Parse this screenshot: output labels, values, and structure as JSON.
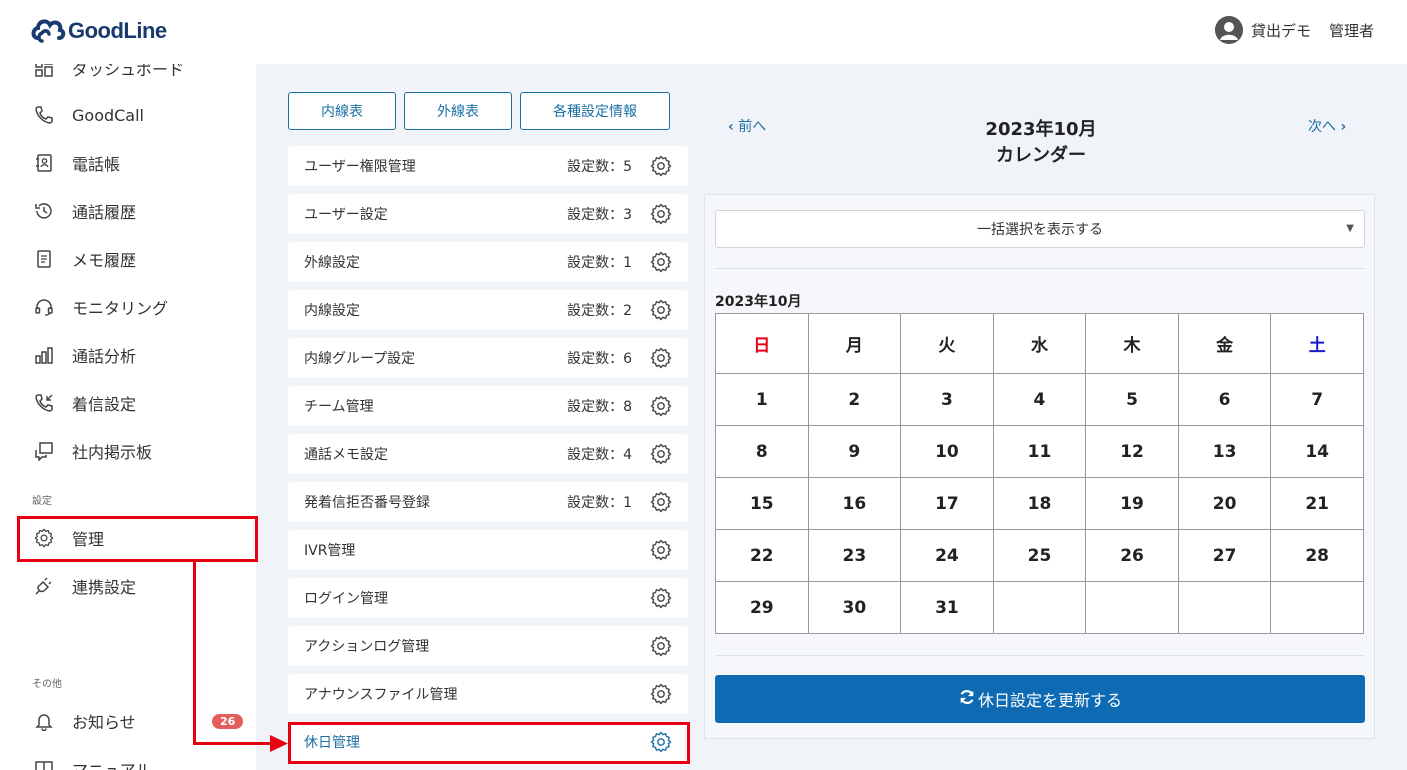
{
  "header": {
    "logo_text": "GoodLine",
    "user_name": "貸出デモ",
    "user_role": "管理者"
  },
  "sidebar": {
    "items": [
      {
        "label": "ダッシュボード",
        "icon": "dashboard-icon"
      },
      {
        "label": "GoodCall",
        "icon": "phone-icon"
      },
      {
        "label": "電話帳",
        "icon": "contacts-icon"
      },
      {
        "label": "通話履歴",
        "icon": "history-icon"
      },
      {
        "label": "メモ履歴",
        "icon": "memo-icon"
      },
      {
        "label": "モニタリング",
        "icon": "headset-icon"
      },
      {
        "label": "通話分析",
        "icon": "bar-chart-icon"
      },
      {
        "label": "着信設定",
        "icon": "incoming-call-icon"
      },
      {
        "label": "社内掲示板",
        "icon": "board-icon"
      }
    ],
    "section_settings": "設定",
    "settings_items": [
      {
        "label": "管理",
        "icon": "gear-icon"
      },
      {
        "label": "連携設定",
        "icon": "plug-icon"
      }
    ],
    "section_other": "その他",
    "other_items": [
      {
        "label": "お知らせ",
        "icon": "bell-icon",
        "badge": "26"
      },
      {
        "label": "マニュアル",
        "icon": "manual-icon"
      }
    ]
  },
  "top_buttons": [
    "内線表",
    "外線表",
    "各種設定情報"
  ],
  "settings_list": [
    {
      "label": "ユーザー権限管理",
      "count": "設定数：5"
    },
    {
      "label": "ユーザー設定",
      "count": "設定数：3"
    },
    {
      "label": "外線設定",
      "count": "設定数：1"
    },
    {
      "label": "内線設定",
      "count": "設定数：2"
    },
    {
      "label": "内線グループ設定",
      "count": "設定数：6"
    },
    {
      "label": "チーム管理",
      "count": "設定数：8"
    },
    {
      "label": "通話メモ設定",
      "count": "設定数：4"
    },
    {
      "label": "発着信拒否番号登録",
      "count": "設定数：1"
    },
    {
      "label": "IVR管理",
      "count": ""
    },
    {
      "label": "ログイン管理",
      "count": ""
    },
    {
      "label": "アクションログ管理",
      "count": ""
    },
    {
      "label": "アナウンスファイル管理",
      "count": ""
    },
    {
      "label": "休日管理",
      "count": ""
    }
  ],
  "calendar": {
    "prev_label": "前へ",
    "next_label": "次へ",
    "title_line1": "2023年10月",
    "title_line2": "カレンダー",
    "bulk_select_label": "一括選択を表示する",
    "month_label": "2023年10月",
    "weekdays": [
      "日",
      "月",
      "火",
      "水",
      "木",
      "金",
      "土"
    ],
    "weeks": [
      [
        "1",
        "2",
        "3",
        "4",
        "5",
        "6",
        "7"
      ],
      [
        "8",
        "9",
        "10",
        "11",
        "12",
        "13",
        "14"
      ],
      [
        "15",
        "16",
        "17",
        "18",
        "19",
        "20",
        "21"
      ],
      [
        "22",
        "23",
        "24",
        "25",
        "26",
        "27",
        "28"
      ],
      [
        "29",
        "30",
        "31",
        "",
        "",
        "",
        ""
      ]
    ],
    "update_button": "休日設定を更新する"
  },
  "colors": {
    "accent": "#1d6fa5",
    "primary_button": "#0e6bb3",
    "highlight": "#e60012",
    "sunday": "#e60012",
    "saturday": "#1a1acc"
  }
}
